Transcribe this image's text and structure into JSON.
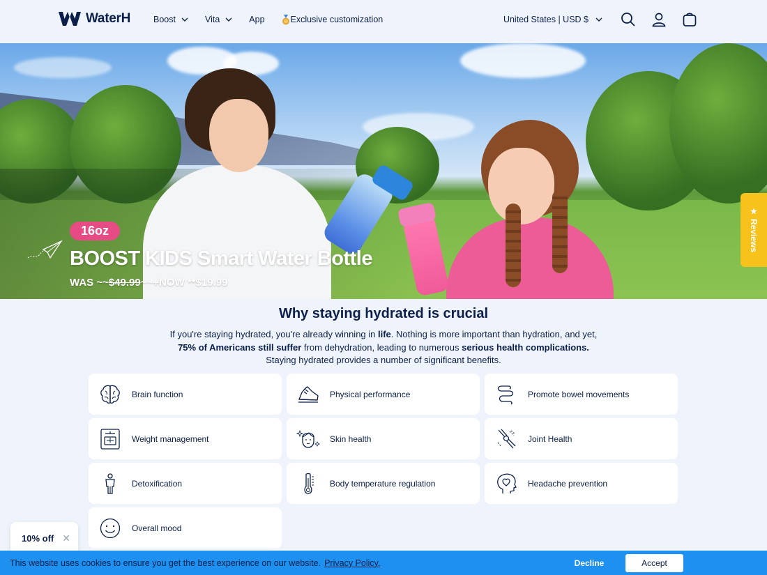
{
  "header": {
    "logo_text": "WaterH",
    "nav": [
      {
        "label": "Boost",
        "has_dropdown": true
      },
      {
        "label": "Vita",
        "has_dropdown": true
      },
      {
        "label": "App",
        "has_dropdown": false
      },
      {
        "label": "Exclusive customization",
        "has_dropdown": false,
        "icon": "medal-icon"
      }
    ],
    "locale": "United States | USD $",
    "icons": [
      "search-icon",
      "account-icon",
      "cart-icon"
    ]
  },
  "hero": {
    "badge": "16oz",
    "title": "BOOST KIDS Smart Water Bottle",
    "price_prefix": "WAS ~~",
    "was_price": "$49.99",
    "price_mid": "~~+NOW **",
    "now_price": "$19.99",
    "reviews_tab": "Reviews",
    "colors": {
      "badge": "#e64b84",
      "reviews": "#f7c21c"
    }
  },
  "section": {
    "title": "Why staying hydrated is crucial",
    "intro": {
      "p1": "If you're staying hydrated, you're already winning in ",
      "b1": "life",
      "p2": ". Nothing is more important than hydration, and yet, ",
      "b2": "75% of Americans still suffer",
      "p3": " from dehydration, leading to numerous ",
      "b3": "serious",
      "p4": " ",
      "b4": "health complications.",
      "p5": " Staying hydrated provides a number of significant benefits."
    }
  },
  "benefits": [
    {
      "label": "Brain function",
      "icon": "brain-icon"
    },
    {
      "label": "Physical performance",
      "icon": "sneaker-icon"
    },
    {
      "label": "Promote bowel movements",
      "icon": "intestine-icon"
    },
    {
      "label": "Weight management",
      "icon": "scale-icon"
    },
    {
      "label": "Skin health",
      "icon": "face-sparkle-icon"
    },
    {
      "label": "Joint Health",
      "icon": "joint-icon"
    },
    {
      "label": "Detoxification",
      "icon": "body-icon"
    },
    {
      "label": "Body temperature regulation",
      "icon": "thermometer-icon"
    },
    {
      "label": "Headache prevention",
      "icon": "head-heart-icon"
    },
    {
      "label": "Overall mood",
      "icon": "smile-icon"
    }
  ],
  "discount": {
    "label": "10% off",
    "close": "✕"
  },
  "cookie": {
    "text": "This website uses cookies to ensure you get the best experience on our website.",
    "link": "Privacy Policy.",
    "decline": "Decline",
    "accept": "Accept",
    "color": "#1d90f0"
  }
}
